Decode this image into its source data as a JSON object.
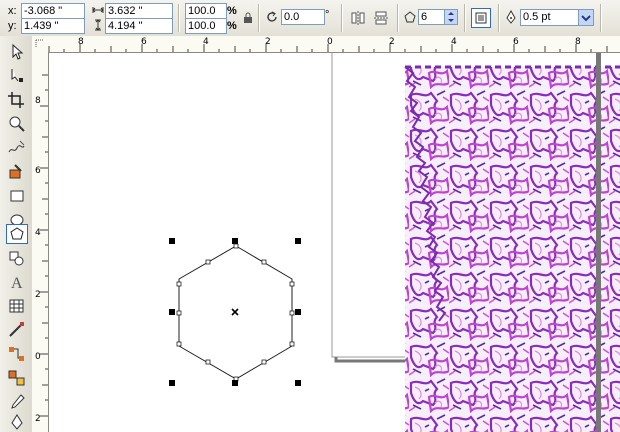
{
  "property_bar": {
    "x_label": "x:",
    "y_label": "y:",
    "x_value": "-3.068 \"",
    "y_value": "1.439 \"",
    "width_value": "3.632 \"",
    "height_value": "4.194 \"",
    "scale_x": "100.0",
    "scale_y": "100.0",
    "percent_symbol": "%",
    "rotation_value": "0.0",
    "degree_symbol": "°",
    "sides_value": "6",
    "outline_width": "0.5 pt"
  },
  "ruler": {
    "horizontal_labels": [
      "8",
      "6",
      "4",
      "2",
      "0",
      "2",
      "4",
      "6",
      "8"
    ],
    "vertical_labels": [
      "8",
      "6",
      "4",
      "2",
      "0",
      "2"
    ]
  },
  "toolbox": {
    "tools": [
      "pick-tool",
      "shape-tool",
      "crop-tool",
      "zoom-tool",
      "freehand-tool",
      "smart-fill-tool",
      "rectangle-tool",
      "ellipse-tool",
      "polygon-tool",
      "basic-shapes-tool",
      "text-tool",
      "table-tool",
      "dimension-tool",
      "connector-tool",
      "blend-tool",
      "eyedropper-tool",
      "outline-tool",
      "fill-tool"
    ],
    "active_tool": "polygon-tool"
  },
  "colors": {
    "accent": "#316ac5",
    "pattern_purple": "#9b2fc6",
    "pattern_magenta": "#d44fd8"
  }
}
